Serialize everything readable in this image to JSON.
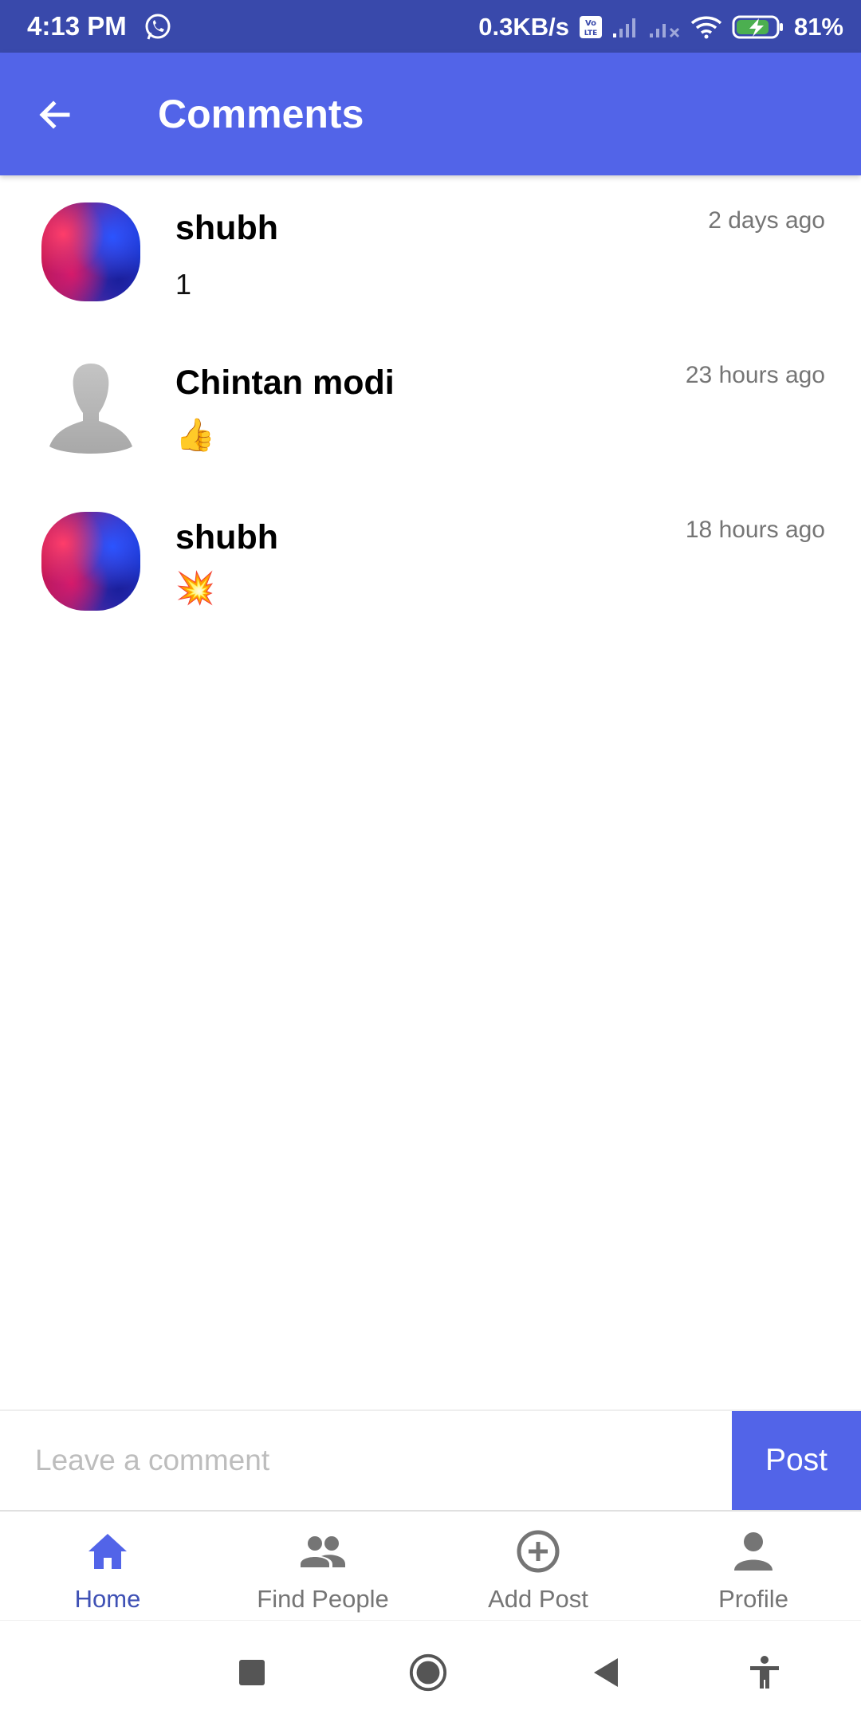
{
  "status_bar": {
    "time": "4:13 PM",
    "speed": "0.3KB/s",
    "battery": "81%",
    "icons": [
      "whatsapp-icon",
      "volte-icon",
      "signal-icon",
      "signal-no-service-icon",
      "wifi-icon",
      "battery-charging-icon"
    ]
  },
  "app_bar": {
    "title": "Comments",
    "back_icon": "arrow-back-icon"
  },
  "comments": [
    {
      "name": "shubh",
      "time": "2 days ago",
      "text": "1",
      "avatar": "colorful-smoke"
    },
    {
      "name": "Chintan modi",
      "time": "23 hours ago",
      "text": "👍",
      "avatar": "default-person"
    },
    {
      "name": "shubh",
      "time": "18 hours ago",
      "text": "💥",
      "avatar": "colorful-smoke"
    }
  ],
  "comment_input": {
    "placeholder": "Leave a comment",
    "value": "",
    "post_label": "Post"
  },
  "bottom_nav": {
    "items": [
      {
        "label": "Home",
        "icon": "home-icon",
        "active": true
      },
      {
        "label": "Find People",
        "icon": "people-icon",
        "active": false
      },
      {
        "label": "Add Post",
        "icon": "add-circle-icon",
        "active": false
      },
      {
        "label": "Profile",
        "icon": "person-icon",
        "active": false
      }
    ]
  },
  "system_nav": {
    "icons": [
      "recents-icon",
      "home-circle-icon",
      "back-triangle-icon",
      "accessibility-icon"
    ]
  },
  "colors": {
    "status_bar": "#3949ab",
    "primary": "#5264e8",
    "active_nav": "#3f51b5",
    "inactive_nav": "#757575"
  }
}
